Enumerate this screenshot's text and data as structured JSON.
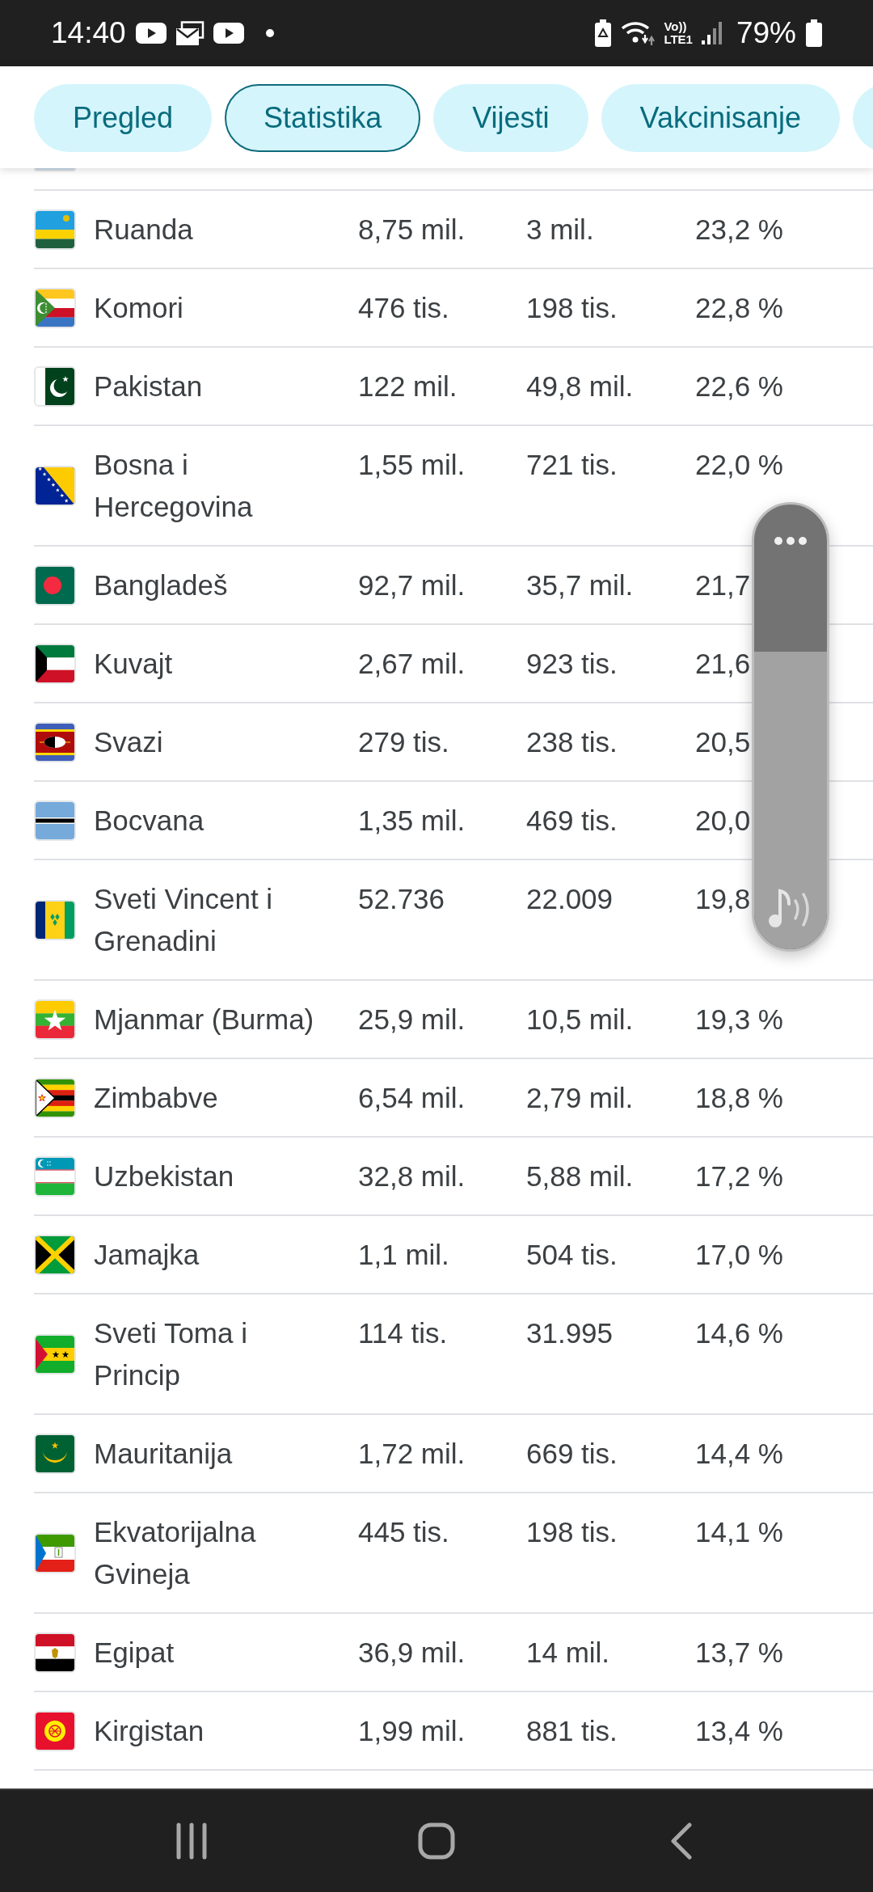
{
  "status_bar": {
    "time": "14:40",
    "volte": "Vo))",
    "network": "LTE1",
    "battery": "79%"
  },
  "tabs": [
    {
      "label": "Pregled",
      "selected": false
    },
    {
      "label": "Statistika",
      "selected": true
    },
    {
      "label": "Vijesti",
      "selected": false
    },
    {
      "label": "Vakcinisanje",
      "selected": false
    },
    {
      "selected": false
    }
  ],
  "table": {
    "rows": [
      {
        "name": "Ruanda",
        "column_2": "8,75 mil.",
        "column_3": "3 mil.",
        "column_4": "23,2 %"
      },
      {
        "name": "Komori",
        "column_2": "476 tis.",
        "column_3": "198 tis.",
        "column_4": "22,8 %"
      },
      {
        "name": "Pakistan",
        "column_2": "122 mil.",
        "column_3": "49,8 mil.",
        "column_4": "22,6 %"
      },
      {
        "name": "Bosna i Hercegovina",
        "column_2": "1,55 mil.",
        "column_3": "721 tis.",
        "column_4": "22,0 %"
      },
      {
        "name": "Bangladeš",
        "column_2": "92,7 mil.",
        "column_3": "35,7 mil.",
        "column_4": "21,7"
      },
      {
        "name": "Kuvajt",
        "column_2": "2,67 mil.",
        "column_3": "923 tis.",
        "column_4": "21,6"
      },
      {
        "name": "Svazi",
        "column_2": "279 tis.",
        "column_3": "238 tis.",
        "column_4": "20,5"
      },
      {
        "name": "Bocvana",
        "column_2": "1,35 mil.",
        "column_3": "469 tis.",
        "column_4": "20,0"
      },
      {
        "name": "Sveti Vincent i Grenadini",
        "column_2": "52.736",
        "column_3": "22.009",
        "column_4": "19,8"
      },
      {
        "name": "Mjanmar (Burma)",
        "column_2": "25,9 mil.",
        "column_3": "10,5 mil.",
        "column_4": "19,3 %"
      },
      {
        "name": "Zimbabve",
        "column_2": "6,54 mil.",
        "column_3": "2,79 mil.",
        "column_4": "18,8 %"
      },
      {
        "name": "Uzbekistan",
        "column_2": "32,8 mil.",
        "column_3": "5,88 mil.",
        "column_4": "17,2 %"
      },
      {
        "name": "Jamajka",
        "column_2": "1,1 mil.",
        "column_3": "504 tis.",
        "column_4": "17,0 %"
      },
      {
        "name": "Sveti Toma i Princip",
        "column_2": "114 tis.",
        "column_3": "31.995",
        "column_4": "14,6 %"
      },
      {
        "name": "Mauritanija",
        "column_2": "1,72 mil.",
        "column_3": "669 tis.",
        "column_4": "14,4 %"
      },
      {
        "name": "Ekvatorijalna Gvineja",
        "column_2": "445 tis.",
        "column_3": "198 tis.",
        "column_4": "14,1 %"
      },
      {
        "name": "Egipat",
        "column_2": "36,9 mil.",
        "column_3": "14 mil.",
        "column_4": "13,7 %"
      },
      {
        "name": "Kirgistan",
        "column_2": "1,99 mil.",
        "column_3": "881 tis.",
        "column_4": "13,4 %"
      }
    ]
  },
  "volume_panel": {
    "level": 0.67
  }
}
